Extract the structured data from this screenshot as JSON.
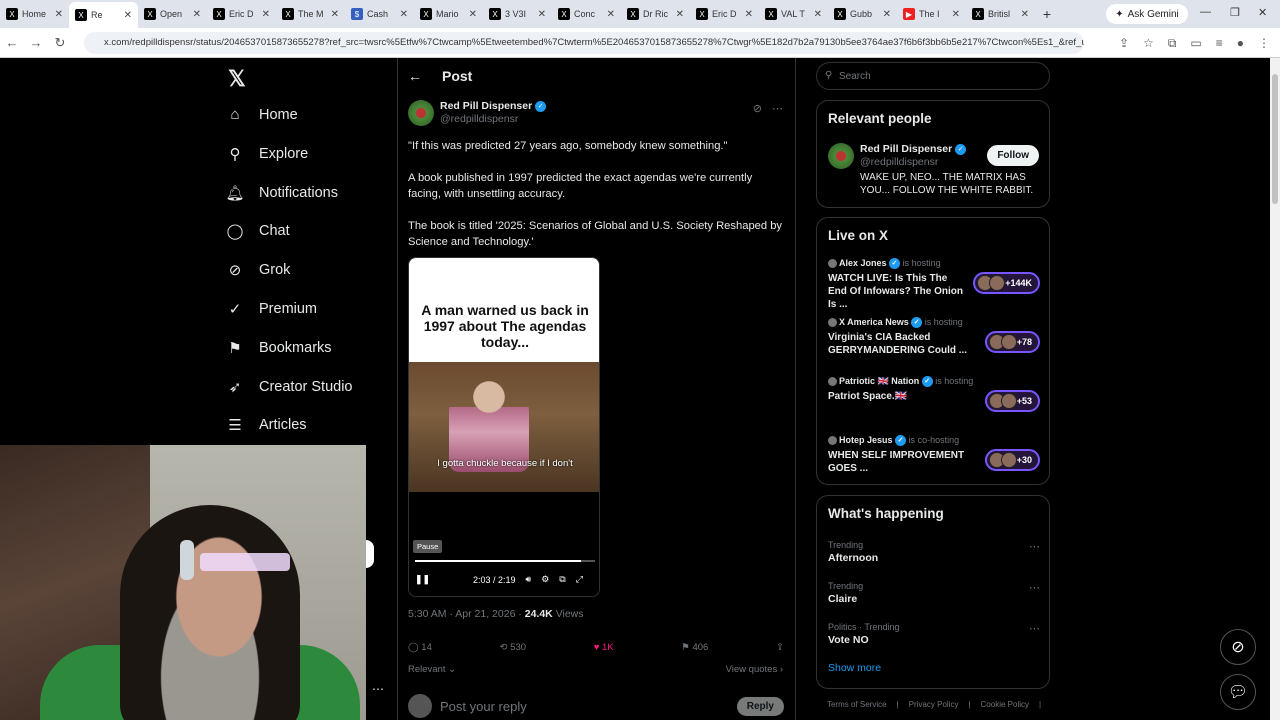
{
  "browser": {
    "tabs": [
      {
        "title": "Home",
        "icon": "x"
      },
      {
        "title": "Re",
        "icon": "x",
        "active": true
      },
      {
        "title": "Open",
        "icon": "x"
      },
      {
        "title": "Eric D",
        "icon": "x"
      },
      {
        "title": "The M",
        "icon": "x"
      },
      {
        "title": "Cash",
        "icon": "blue"
      },
      {
        "title": "Mario",
        "icon": "x"
      },
      {
        "title": "3 V3I",
        "icon": "x"
      },
      {
        "title": "Conc",
        "icon": "x"
      },
      {
        "title": "Dr Ric",
        "icon": "x"
      },
      {
        "title": "Eric D",
        "icon": "x"
      },
      {
        "title": "VAL T",
        "icon": "x"
      },
      {
        "title": "Gubb",
        "icon": "x"
      },
      {
        "title": "The I",
        "icon": "yt"
      },
      {
        "title": "Britisl",
        "icon": "x"
      }
    ],
    "new_tab": "+",
    "ask_gemini": "Ask Gemini",
    "url": "x.com/redpilldispensr/status/2046537015873655278?ref_src=twsrc%5Etfw%7Ctwcamp%5Etweetembed%7Ctwterm%5E2046537015873655278%7Ctwgr%5E182d7b2a79130b5ee3764ae37f6b6f3bb6b5e217%7Ctwcon%5Es1_&ref_url=htt..."
  },
  "nav": {
    "items": [
      {
        "label": "Home",
        "icon": "home-icon",
        "glyph": "⌂"
      },
      {
        "label": "Explore",
        "icon": "search-icon",
        "glyph": "⚲"
      },
      {
        "label": "Notifications",
        "icon": "bell-icon",
        "glyph": "🔔︎"
      },
      {
        "label": "Chat",
        "icon": "chat-icon",
        "glyph": "◯"
      },
      {
        "label": "Grok",
        "icon": "grok-icon",
        "glyph": "⊘"
      },
      {
        "label": "Premium",
        "icon": "premium-icon",
        "glyph": "✓"
      },
      {
        "label": "Bookmarks",
        "icon": "bookmark-icon",
        "glyph": "⚑"
      },
      {
        "label": "Creator Studio",
        "icon": "rocket-icon",
        "glyph": "➶"
      },
      {
        "label": "Articles",
        "icon": "article-icon",
        "glyph": "☰"
      }
    ]
  },
  "post": {
    "header": "Post",
    "author_name": "Red Pill Dispenser",
    "author_handle": "@redpilldispensr",
    "text": [
      "\"If this was predicted 27 years ago, somebody knew something.\"",
      "A book published in 1997 predicted the exact agendas we're currently facing, with unsettling accuracy.",
      "The book is titled '2025: Scenarios of Global and U.S. Society Reshaped by Science and Technology.'"
    ],
    "video": {
      "overlay_text": "A man warned us back in 1997 about The agendas today...",
      "caption": "I gotta chuckle because if I don't",
      "tooltip": "Pause",
      "time": "2:03 / 2:19",
      "progress": 0.92
    },
    "timestamp": "5:30 AM · Apr 21, 2026 · ",
    "views_count": "24.4K",
    "views_label": " Views",
    "replies": "14",
    "reposts": "530",
    "likes": "1K",
    "bookmarks": "406",
    "relevant": "Relevant ⌄",
    "view_quotes": "View quotes ›",
    "reply_placeholder": "Post your reply",
    "reply_button": "Reply"
  },
  "sidebar": {
    "search_placeholder": "Search",
    "relevant_people": {
      "title": "Relevant people",
      "name": "Red Pill Dispenser",
      "handle": "@redpilldispensr",
      "bio": "WAKE UP, NEO... THE MATRIX HAS YOU... FOLLOW THE WHITE RABBIT.",
      "follow": "Follow"
    },
    "live": {
      "title": "Live on X",
      "items": [
        {
          "host": "Alex Jones",
          "role": "is hosting",
          "title": "WATCH LIVE: Is This The End Of Infowars? The Onion Is ...",
          "count": "+144K"
        },
        {
          "host": "X America News",
          "role": "is hosting",
          "title": "Virginia's CIA Backed GERRYMANDERING Could ...",
          "count": "+78"
        },
        {
          "host": "Patriotic 🇬🇧 Nation",
          "role": "is hosting",
          "title": "Patriot Space.🇬🇧",
          "count": "+53"
        },
        {
          "host": "Hotep Jesus",
          "role": "is co-hosting",
          "title": "WHEN SELF IMPROVEMENT GOES ...",
          "count": "+30"
        }
      ]
    },
    "happening": {
      "title": "What's happening",
      "items": [
        {
          "category": "Trending",
          "name": "Afternoon"
        },
        {
          "category": "Trending",
          "name": "Claire"
        },
        {
          "category": "Politics · Trending",
          "name": "Vote NO"
        }
      ],
      "show_more": "Show more"
    },
    "footer": [
      "Terms of Service",
      "|",
      "Privacy Policy",
      "|",
      "Cookie Policy",
      "|"
    ]
  }
}
